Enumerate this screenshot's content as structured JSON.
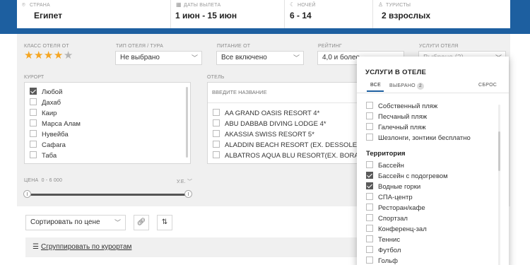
{
  "search": {
    "fields": [
      {
        "label": "Страна",
        "value": "Египет",
        "icon": "location-pin-icon"
      },
      {
        "label": "Даты вылета",
        "value": "1 июн - 15 июн",
        "icon": "calendar-icon"
      },
      {
        "label": "Ночей",
        "value": "6 - 14",
        "icon": "moon-icon"
      },
      {
        "label": "Туристы",
        "value": "2 взрослых",
        "icon": "person-icon"
      }
    ]
  },
  "filters": {
    "hotel_class": {
      "label": "Класс отеля от",
      "stars_filled": 4,
      "stars_total": 5
    },
    "hotel_type": {
      "label": "Тип отеля / тура",
      "value": "Не выбрано"
    },
    "meal": {
      "label": "Питание от",
      "value": "Все включено"
    },
    "rating": {
      "label": "Рейтинг",
      "value": "4,0 и более"
    },
    "services": {
      "label": "Услуги отеля",
      "value": "Выбрано (2)"
    },
    "resort": {
      "label": "Курорт",
      "items": [
        {
          "name": "Любой",
          "checked": true
        },
        {
          "name": "Дахаб",
          "checked": false
        },
        {
          "name": "Каир",
          "checked": false
        },
        {
          "name": "Марса Алам",
          "checked": false
        },
        {
          "name": "Нувейба",
          "checked": false
        },
        {
          "name": "Сафага",
          "checked": false
        },
        {
          "name": "Таба",
          "checked": false
        }
      ]
    },
    "hotel": {
      "label": "Отель",
      "placeholder": "Введите название",
      "items": [
        "AA GRAND OASIS RESORT 4*",
        "ABU DABBAB DIVING LODGE 4*",
        "AKASSIA SWISS RESORT 5*",
        "ALADDIN BEACH RESORT (EX. DESSOLE ALADDIN",
        "ALBATROS AQUA BLU RESORT(EX. BORA BORA"
      ]
    },
    "price": {
      "label": "Цена",
      "range": "0 - 6 000",
      "currency": "у.е.",
      "min_fraction": 0,
      "max_fraction": 1
    }
  },
  "results": {
    "sort_label": "Сортировать по цене",
    "group_label": "Сгруппировать по курортам"
  },
  "services_popup": {
    "title": "Услуги в отеле",
    "tabs": {
      "all": "Все",
      "selected": "Выбрано",
      "selected_count": "2",
      "reset": "Сброс"
    },
    "beach_items": [
      {
        "name": "Собственный пляж",
        "checked": false
      },
      {
        "name": "Песчаный пляж",
        "checked": false
      },
      {
        "name": "Галечный пляж",
        "checked": false
      },
      {
        "name": "Шезлонги, зонтики бесплатно",
        "checked": false
      }
    ],
    "territory_title": "Территория",
    "territory_items": [
      {
        "name": "Бассейн",
        "checked": false
      },
      {
        "name": "Бассейн с подогревом",
        "checked": true
      },
      {
        "name": "Водные горки",
        "checked": true
      },
      {
        "name": "СПА-центр",
        "checked": false
      },
      {
        "name": "Ресторан/кафе",
        "checked": false
      },
      {
        "name": "Спортзал",
        "checked": false
      },
      {
        "name": "Конференц-зал",
        "checked": false
      },
      {
        "name": "Теннис",
        "checked": false
      },
      {
        "name": "Футбол",
        "checked": false
      },
      {
        "name": "Гольф",
        "checked": false
      }
    ]
  },
  "colors": {
    "brand_blue": "#1d5fa0",
    "star": "#f5a623"
  }
}
